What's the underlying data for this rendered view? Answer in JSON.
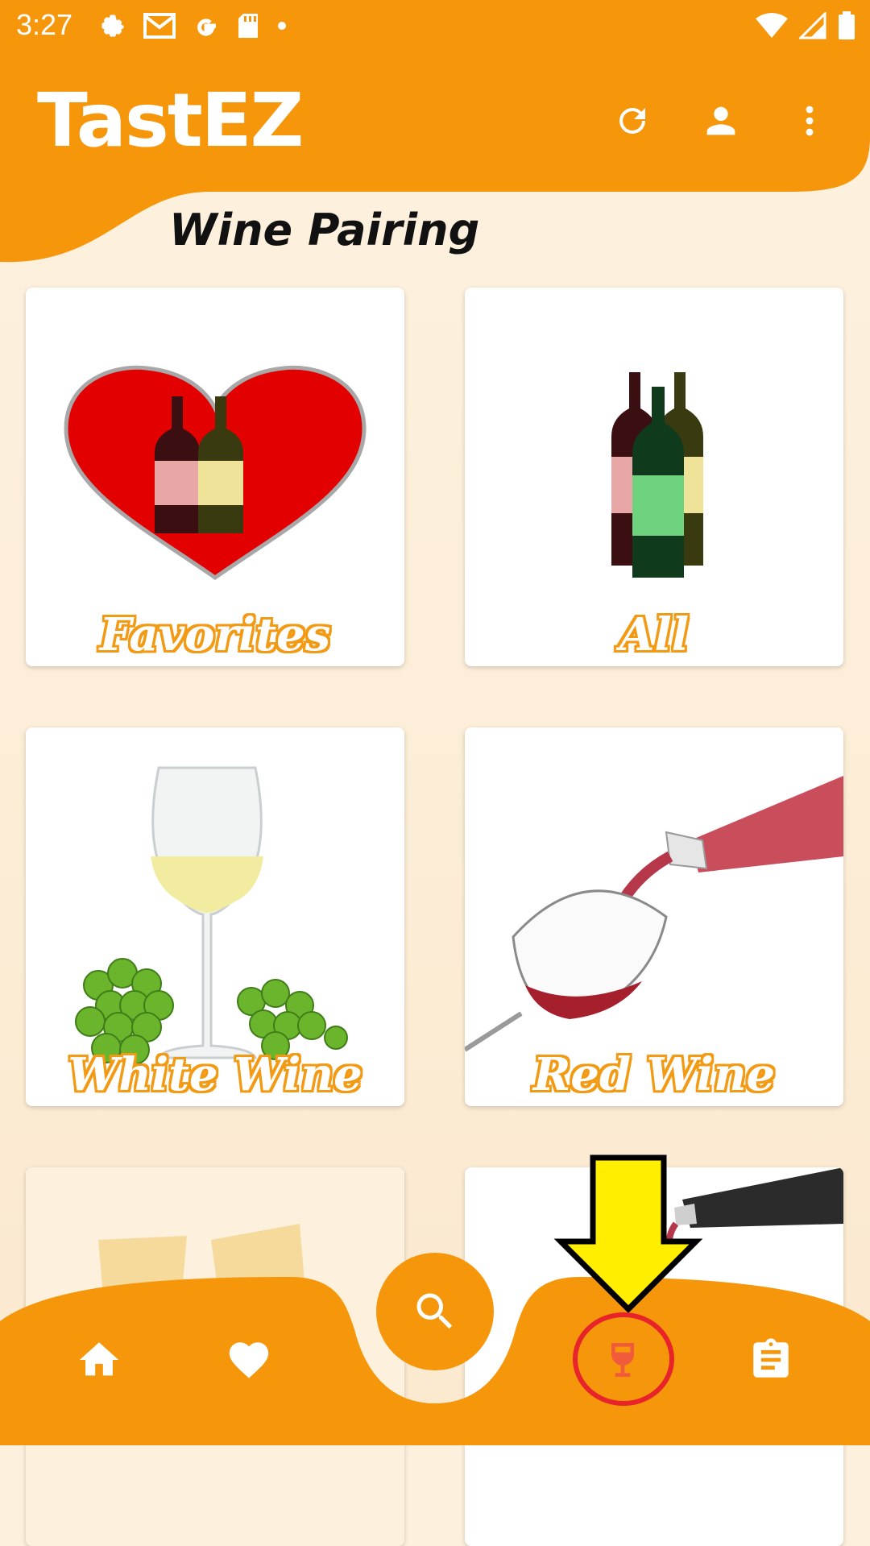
{
  "status_bar": {
    "time": "3:27",
    "left_icons": [
      "settings-icon",
      "gmail-icon",
      "google-icon",
      "sd-card-icon",
      "dot-icon"
    ],
    "right_icons": [
      "wifi-icon",
      "signal-icon",
      "battery-icon"
    ]
  },
  "header": {
    "app_title": "TastEZ",
    "actions": [
      "refresh-icon",
      "account-icon",
      "more-vert-icon"
    ],
    "section_title": "Wine Pairing"
  },
  "cards": [
    {
      "label": "Favorites",
      "image": "heart-with-wine-bottles"
    },
    {
      "label": "All",
      "image": "three-wine-bottles"
    },
    {
      "label": "White Wine",
      "image": "white-wine-glass-with-grapes"
    },
    {
      "label": "Red Wine",
      "image": "red-wine-pouring-into-glass"
    },
    {
      "label": "",
      "image": "sparkling-wine-glasses"
    },
    {
      "label": "",
      "image": "wine-bottle-pouring"
    }
  ],
  "bottom_nav": {
    "items": [
      "home-icon",
      "favorite-icon",
      "search-icon",
      "wine-glass-icon",
      "clipboard-icon"
    ],
    "selected": "wine-glass-icon"
  },
  "colors": {
    "primary": "#f6960b",
    "background": "#fdf0dc",
    "label_outline": "#f39a14",
    "selected_nav_icon": "#f25a3c",
    "highlight_circle": "#e8232a",
    "annotation_arrow": "#ffee00"
  }
}
